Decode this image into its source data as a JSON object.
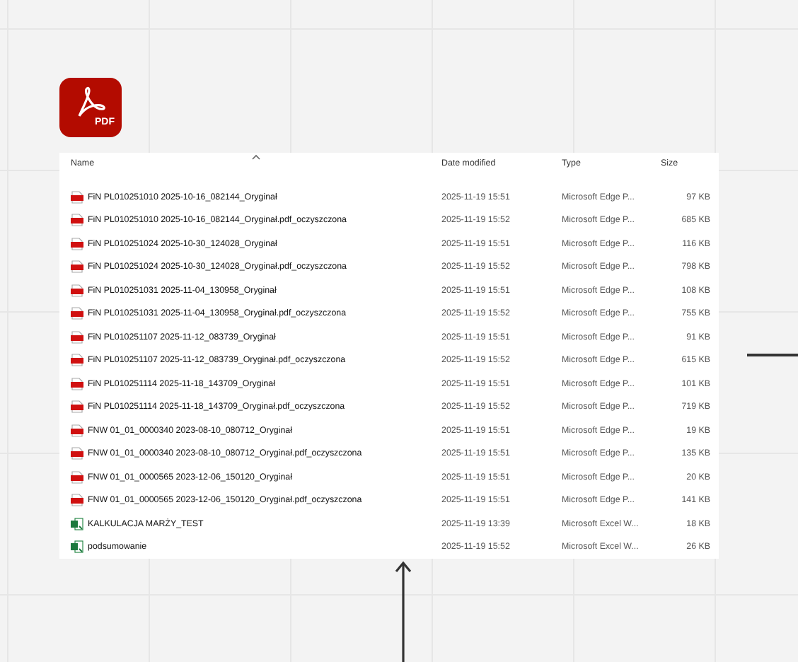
{
  "app_icon": {
    "label": "PDF"
  },
  "file_list": {
    "columns": [
      "Name",
      "Date modified",
      "Type",
      "Size"
    ],
    "rows": [
      {
        "kind": "pdf",
        "name": "FiN PL010251010 2025-10-16_082144_Oryginał",
        "date": "2025-11-19 15:51",
        "type": "Microsoft Edge P...",
        "size": "97 KB"
      },
      {
        "kind": "pdf",
        "name": "FiN PL010251010 2025-10-16_082144_Oryginał.pdf_oczyszczona",
        "date": "2025-11-19 15:52",
        "type": "Microsoft Edge P...",
        "size": "685 KB"
      },
      {
        "kind": "pdf",
        "name": "FiN PL010251024 2025-10-30_124028_Oryginał",
        "date": "2025-11-19 15:51",
        "type": "Microsoft Edge P...",
        "size": "116 KB"
      },
      {
        "kind": "pdf",
        "name": "FiN PL010251024 2025-10-30_124028_Oryginał.pdf_oczyszczona",
        "date": "2025-11-19 15:52",
        "type": "Microsoft Edge P...",
        "size": "798 KB"
      },
      {
        "kind": "pdf",
        "name": "FiN PL010251031 2025-11-04_130958_Oryginał",
        "date": "2025-11-19 15:51",
        "type": "Microsoft Edge P...",
        "size": "108 KB"
      },
      {
        "kind": "pdf",
        "name": "FiN PL010251031 2025-11-04_130958_Oryginał.pdf_oczyszczona",
        "date": "2025-11-19 15:52",
        "type": "Microsoft Edge P...",
        "size": "755 KB"
      },
      {
        "kind": "pdf",
        "name": "FiN PL010251107 2025-11-12_083739_Oryginał",
        "date": "2025-11-19 15:51",
        "type": "Microsoft Edge P...",
        "size": "91 KB"
      },
      {
        "kind": "pdf",
        "name": "FiN PL010251107 2025-11-12_083739_Oryginał.pdf_oczyszczona",
        "date": "2025-11-19 15:52",
        "type": "Microsoft Edge P...",
        "size": "615 KB"
      },
      {
        "kind": "pdf",
        "name": "FiN PL010251114 2025-11-18_143709_Oryginał",
        "date": "2025-11-19 15:51",
        "type": "Microsoft Edge P...",
        "size": "101 KB"
      },
      {
        "kind": "pdf",
        "name": "FiN PL010251114 2025-11-18_143709_Oryginał.pdf_oczyszczona",
        "date": "2025-11-19 15:52",
        "type": "Microsoft Edge P...",
        "size": "719 KB"
      },
      {
        "kind": "pdf",
        "name": "FNW 01_01_0000340 2023-08-10_080712_Oryginał",
        "date": "2025-11-19 15:51",
        "type": "Microsoft Edge P...",
        "size": "19 KB"
      },
      {
        "kind": "pdf",
        "name": "FNW 01_01_0000340 2023-08-10_080712_Oryginał.pdf_oczyszczona",
        "date": "2025-11-19 15:51",
        "type": "Microsoft Edge P...",
        "size": "135 KB"
      },
      {
        "kind": "pdf",
        "name": "FNW 01_01_0000565 2023-12-06_150120_Oryginał",
        "date": "2025-11-19 15:51",
        "type": "Microsoft Edge P...",
        "size": "20 KB"
      },
      {
        "kind": "pdf",
        "name": "FNW 01_01_0000565 2023-12-06_150120_Oryginał.pdf_oczyszczona",
        "date": "2025-11-19 15:51",
        "type": "Microsoft Edge P...",
        "size": "141 KB"
      },
      {
        "kind": "excel",
        "name": "KALKULACJA MARŻY_TEST",
        "date": "2025-11-19 13:39",
        "type": "Microsoft Excel W...",
        "size": "18 KB"
      },
      {
        "kind": "excel",
        "name": "podsumowanie",
        "date": "2025-11-19 15:52",
        "type": "Microsoft Excel W...",
        "size": "26 KB"
      }
    ]
  }
}
